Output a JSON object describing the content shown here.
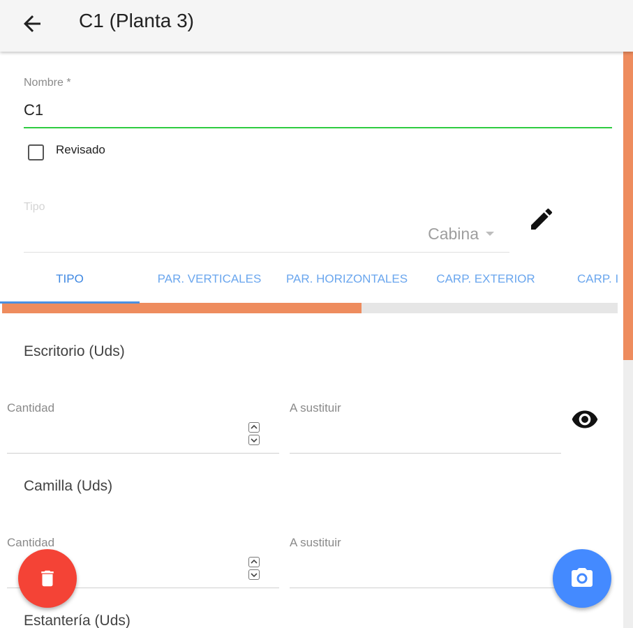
{
  "appbar": {
    "title": "C1 (Planta 3)"
  },
  "form": {
    "nombre_label": "Nombre *",
    "nombre_value": "C1",
    "revisado_label": "Revisado",
    "revisado_checked": false,
    "tipo_label": "Tipo",
    "tipo_value": "Cabina"
  },
  "tabs": [
    {
      "label": "TIPO",
      "active": true
    },
    {
      "label": "PAR. VERTICALES",
      "active": false
    },
    {
      "label": "PAR. HORIZONTALES",
      "active": false
    },
    {
      "label": "CARP. EXTERIOR",
      "active": false
    },
    {
      "label": "CARP. I",
      "active": false
    }
  ],
  "tab_scroll_fraction": 0.58,
  "sections": [
    {
      "title": "Escritorio (Uds)",
      "cantidad_label": "Cantidad",
      "sustituir_label": "A sustituir"
    },
    {
      "title": "Camilla (Uds)",
      "cantidad_label": "Cantidad",
      "sustituir_label": "A sustituir"
    },
    {
      "title": "Estantería (Uds)"
    }
  ],
  "icons": {
    "back": "arrow-back-icon",
    "edit": "pencil-icon",
    "visibility": "eye-icon",
    "delete": "trash-icon",
    "camera": "camera-icon"
  },
  "colors": {
    "accent": "#ee8c5e",
    "tab_text": "#6aa6ee",
    "input_focus": "#2ecc40",
    "delete_fab": "#f44336",
    "camera_fab": "#448aff"
  }
}
